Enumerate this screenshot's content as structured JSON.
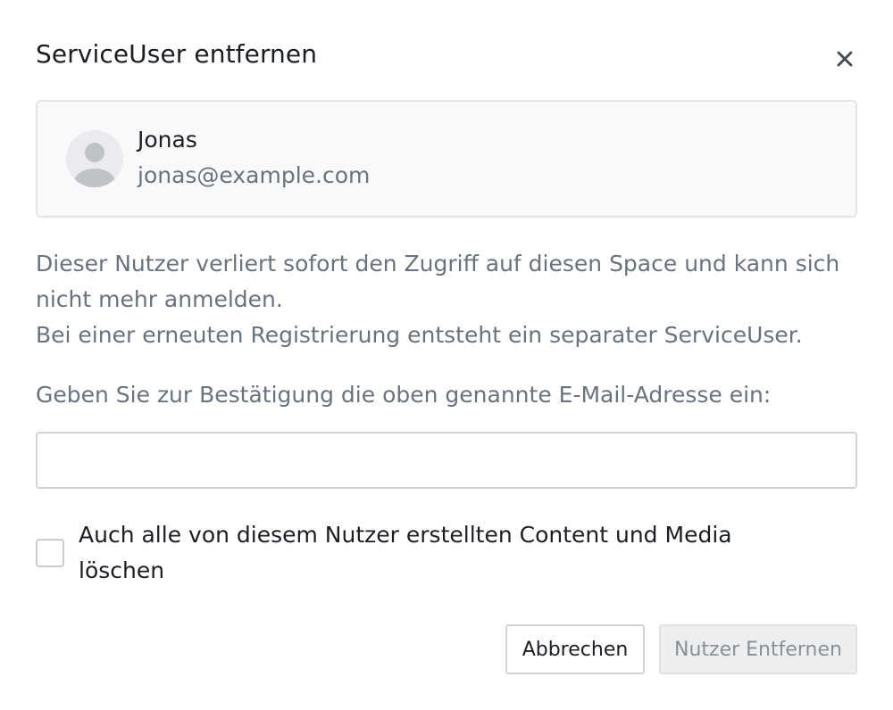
{
  "dialog": {
    "title": "ServiceUser entfernen"
  },
  "user": {
    "name": "Jonas",
    "email": "jonas@example.com"
  },
  "description": {
    "line1": "Dieser Nutzer verliert sofort den Zugriff auf diesen Space und kann sich nicht mehr anmelden.",
    "line2": "Bei einer erneuten Registrierung entsteht ein separater ServiceUser."
  },
  "confirm": {
    "label": "Geben Sie zur Bestätigung die oben genannte E-Mail-Adresse ein:",
    "value": "",
    "placeholder": ""
  },
  "delete_content": {
    "label": "Auch alle von diesem Nutzer erstellten Content und Media löschen",
    "checked": false
  },
  "buttons": {
    "cancel_label": "Abbrechen",
    "remove_label": "Nutzer Entfernen"
  },
  "icons": {
    "close": "close-icon",
    "avatar": "user-avatar-icon"
  },
  "colors": {
    "secondary_text": "#6a737d",
    "disabled_button_bg": "#eceef0",
    "card_bg": "#f8f9fa"
  }
}
